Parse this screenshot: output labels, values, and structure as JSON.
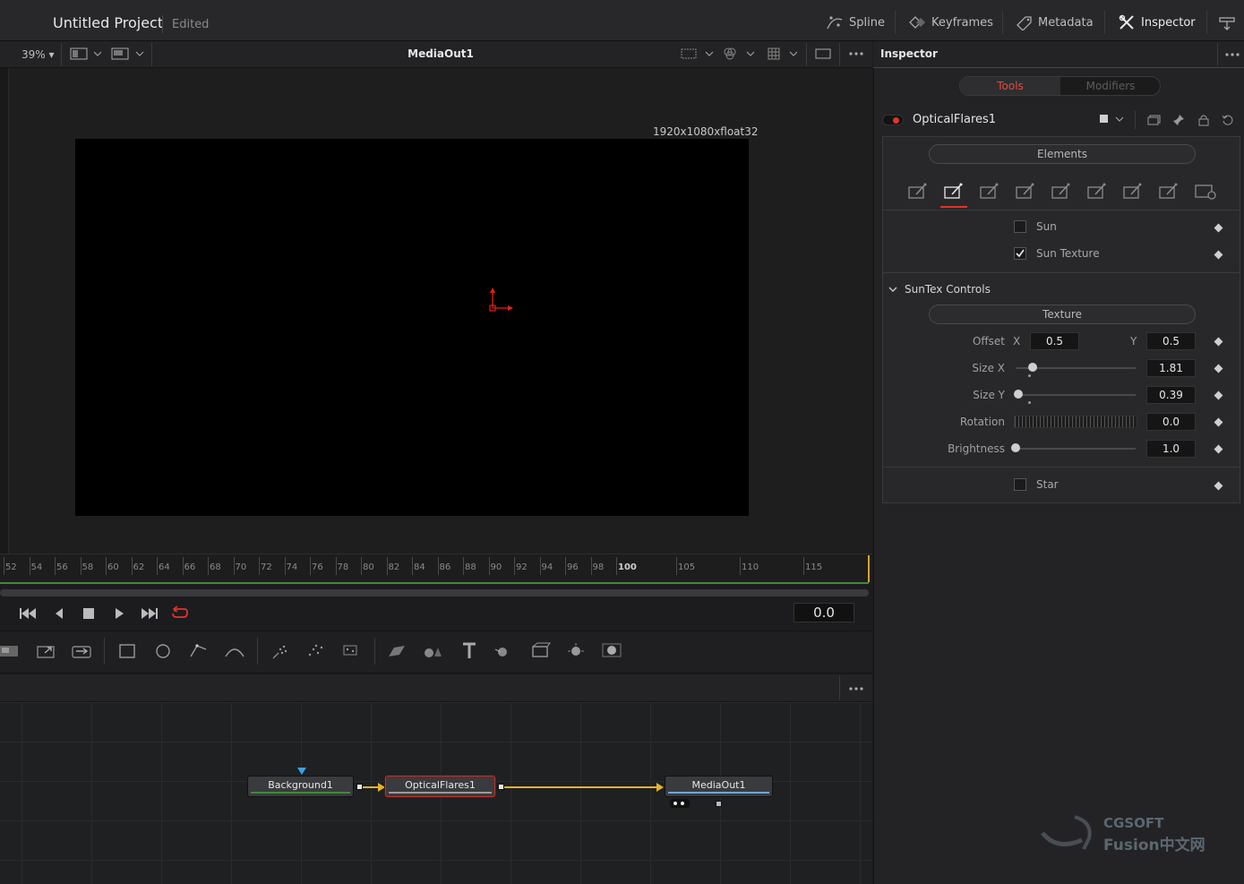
{
  "project": {
    "title": "Untitled Project",
    "status": "Edited"
  },
  "top_tabs": [
    {
      "label": "Spline",
      "icon": "spline-icon"
    },
    {
      "label": "Keyframes",
      "icon": "keyframes-icon"
    },
    {
      "label": "Metadata",
      "icon": "metadata-icon"
    },
    {
      "label": "Inspector",
      "icon": "inspector-icon"
    }
  ],
  "viewer": {
    "zoom": "39%",
    "title": "MediaOut1",
    "resolution": "1920x1080xfloat32"
  },
  "ruler": {
    "labels": [
      "52",
      "54",
      "56",
      "58",
      "60",
      "62",
      "64",
      "66",
      "68",
      "70",
      "72",
      "74",
      "76",
      "78",
      "80",
      "82",
      "84",
      "86",
      "88",
      "90",
      "92",
      "94",
      "96",
      "98",
      "100",
      "105",
      "110",
      "115"
    ]
  },
  "transport": {
    "time": "0.0"
  },
  "nodes": {
    "background": "Background1",
    "optical": "OpticalFlares1",
    "mediaout": "MediaOut1"
  },
  "inspector": {
    "title": "Inspector",
    "tabs": {
      "tools": "Tools",
      "modifiers": "Modifiers"
    },
    "tool_name": "OpticalFlares1",
    "elements_label": "Elements",
    "checkboxes": {
      "sun": {
        "label": "Sun",
        "checked": false
      },
      "sun_texture": {
        "label": "Sun Texture",
        "checked": true
      },
      "star": {
        "label": "Star",
        "checked": false
      }
    },
    "section": "SunTex Controls",
    "texture_label": "Texture",
    "offset": {
      "label": "Offset",
      "x_label": "X",
      "x": "0.5",
      "y_label": "Y",
      "y": "0.5"
    },
    "size_x": {
      "label": "Size X",
      "value": "1.81",
      "fraction": 0.14
    },
    "size_y": {
      "label": "Size Y",
      "value": "0.39",
      "fraction": 0.02
    },
    "rotation": {
      "label": "Rotation",
      "value": "0.0"
    },
    "brightness": {
      "label": "Brightness",
      "value": "1.0",
      "fraction": 0.0
    }
  },
  "watermark": {
    "line1": "CGSOFT",
    "line2": "Fusion中文网"
  },
  "colors": {
    "accent_red": "#e0342b",
    "link_yellow": "#e3b42a",
    "bg_green": "#3f8b3a"
  }
}
